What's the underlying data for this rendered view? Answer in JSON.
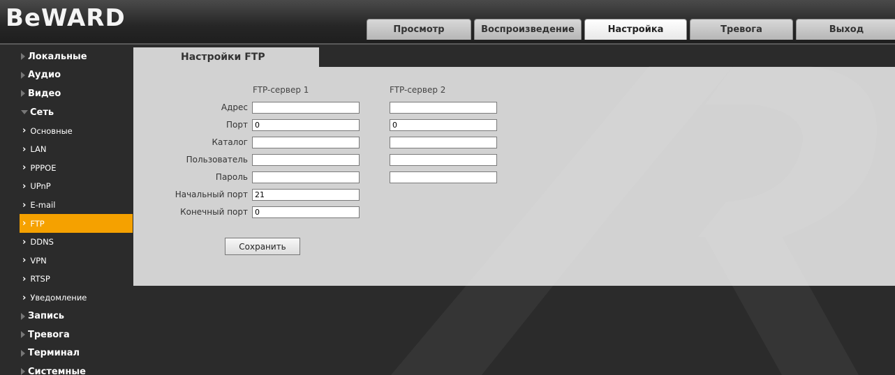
{
  "brand": {
    "logo": "BeWARD"
  },
  "tabs": [
    {
      "label": "Просмотр",
      "active": false
    },
    {
      "label": "Воспроизведение",
      "active": false
    },
    {
      "label": "Настройка",
      "active": true
    },
    {
      "label": "Тревога",
      "active": false
    },
    {
      "label": "Выход",
      "active": false
    }
  ],
  "sidebar": {
    "items": [
      {
        "label": "Локальные",
        "level": "top"
      },
      {
        "label": "Аудио",
        "level": "top"
      },
      {
        "label": "Видео",
        "level": "top"
      },
      {
        "label": "Сеть",
        "level": "top",
        "expanded": true
      },
      {
        "label": "Основные",
        "level": "sub"
      },
      {
        "label": "LAN",
        "level": "sub"
      },
      {
        "label": "PPPOE",
        "level": "sub"
      },
      {
        "label": "UPnP",
        "level": "sub"
      },
      {
        "label": "E-mail",
        "level": "sub"
      },
      {
        "label": "FTP",
        "level": "sub",
        "selected": true
      },
      {
        "label": "DDNS",
        "level": "sub"
      },
      {
        "label": "VPN",
        "level": "sub"
      },
      {
        "label": "RTSP",
        "level": "sub"
      },
      {
        "label": "Уведомление",
        "level": "sub"
      },
      {
        "label": "Запись",
        "level": "top"
      },
      {
        "label": "Тревога",
        "level": "top"
      },
      {
        "label": "Терминал",
        "level": "top"
      },
      {
        "label": "Системные",
        "level": "top"
      }
    ]
  },
  "ftp": {
    "title": "Настройки FTP",
    "server1_heading": "FTP-сервер 1",
    "server2_heading": "FTP-сервер 2",
    "labels": {
      "address": "Адрес",
      "port": "Порт",
      "directory": "Каталог",
      "user": "Пользователь",
      "password": "Пароль",
      "start_port": "Начальный порт",
      "end_port": "Конечный порт"
    },
    "server1": {
      "address": "",
      "port": "0",
      "directory": "",
      "user": "",
      "password": ""
    },
    "server2": {
      "address": "",
      "port": "0",
      "directory": "",
      "user": "",
      "password": ""
    },
    "start_port": "21",
    "end_port": "0",
    "save_label": "Сохранить"
  },
  "colors": {
    "accent": "#f5a100",
    "panel": "#d2d2d2",
    "background": "#2b2b2b"
  }
}
